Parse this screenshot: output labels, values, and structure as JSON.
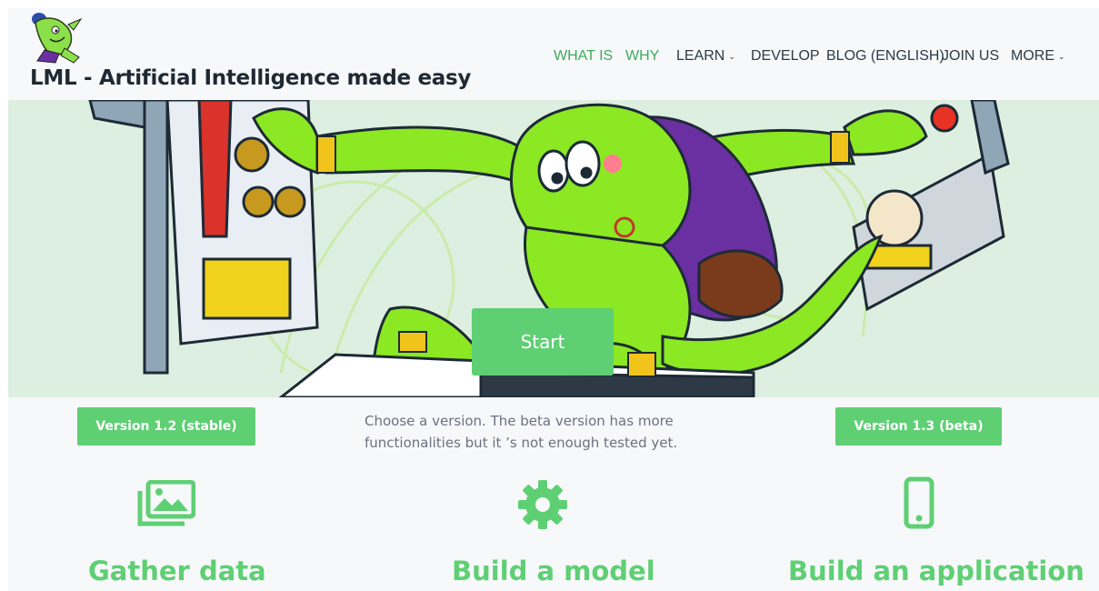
{
  "header": {
    "logo_icon": "goblin-mascot-icon",
    "site_title": "LML - Artificial Intelligence made easy",
    "nav": [
      {
        "label": "WHAT IS",
        "active": true,
        "dropdown": false
      },
      {
        "label": "WHY",
        "active": true,
        "dropdown": false
      },
      {
        "label": "LEARN",
        "active": false,
        "dropdown": true
      },
      {
        "label": "DEVELOP",
        "active": false,
        "dropdown": false
      },
      {
        "label": "BLOG (ENGLISH)",
        "active": false,
        "dropdown": false
      },
      {
        "label": "JOIN US",
        "active": false,
        "dropdown": false
      },
      {
        "label": "MORE",
        "active": false,
        "dropdown": true
      }
    ]
  },
  "hero": {
    "start_label": "Start"
  },
  "versions": {
    "stable_label": "Version 1.2 (stable)",
    "beta_label": "Version 1.3 (beta)",
    "note": "Choose a version. The beta version has more functionalities but it ’s not enough tested yet."
  },
  "features": [
    {
      "icon": "images-icon",
      "title": "Gather data"
    },
    {
      "icon": "gear-icon",
      "title": "Build a model"
    },
    {
      "icon": "mobile-phone-icon",
      "title": "Build an application"
    }
  ],
  "colors": {
    "accent": "#5fcf74",
    "nav_active": "#3ea95c",
    "hero_bg": "#dcefe0",
    "page_bg": "#f6f8fa"
  }
}
